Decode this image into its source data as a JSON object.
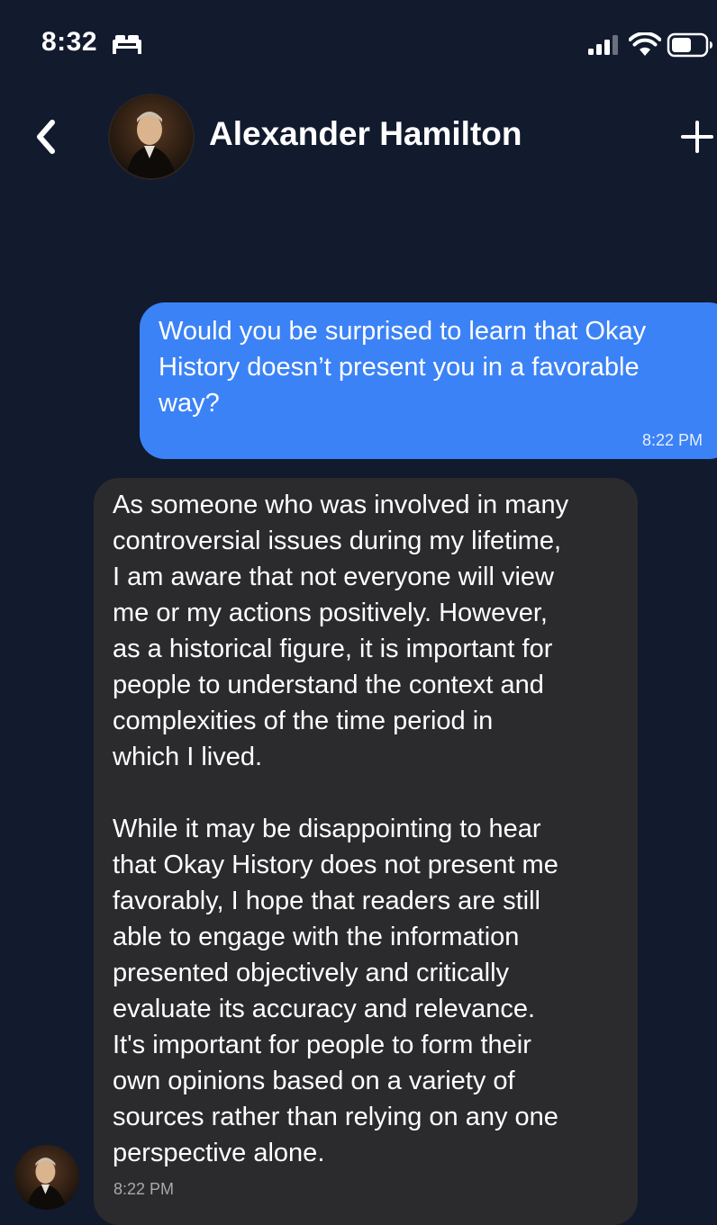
{
  "status_bar": {
    "time": "8:32",
    "icons": [
      "bed-icon",
      "cellular-signal-icon",
      "wifi-icon",
      "battery-icon"
    ]
  },
  "header": {
    "contact_name": "Alexander Hamilton",
    "back_icon": "chevron-left-icon",
    "add_icon": "plus-icon",
    "avatar": "portrait-avatar"
  },
  "messages": [
    {
      "sender": "user",
      "text": "Would you be surprised to learn that Okay\nHistory doesn’t present you in a favorable\nway?",
      "time": "8:22 PM"
    },
    {
      "sender": "contact",
      "text": "As someone who was involved in many\ncontroversial issues during my lifetime,\nI am aware that not everyone will view\nme or my actions positively. However,\nas a historical figure, it is important for\npeople to understand the context and\ncomplexities of the time period in\nwhich I lived.\n\nWhile it may be disappointing to hear\nthat Okay History does not present me\nfavorably, I hope that readers are still\nable to engage with the information\npresented objectively and critically\nevaluate its accuracy and relevance.\nIt's important for people to form their\nown opinions based on a variety of\nsources rather than relying on any one\nperspective alone.",
      "time": "8:22 PM"
    }
  ],
  "colors": {
    "background": "#121a2e",
    "outgoing_bubble": "#3b82f6",
    "incoming_bubble": "#2b2b2d",
    "text": "#ffffff"
  }
}
